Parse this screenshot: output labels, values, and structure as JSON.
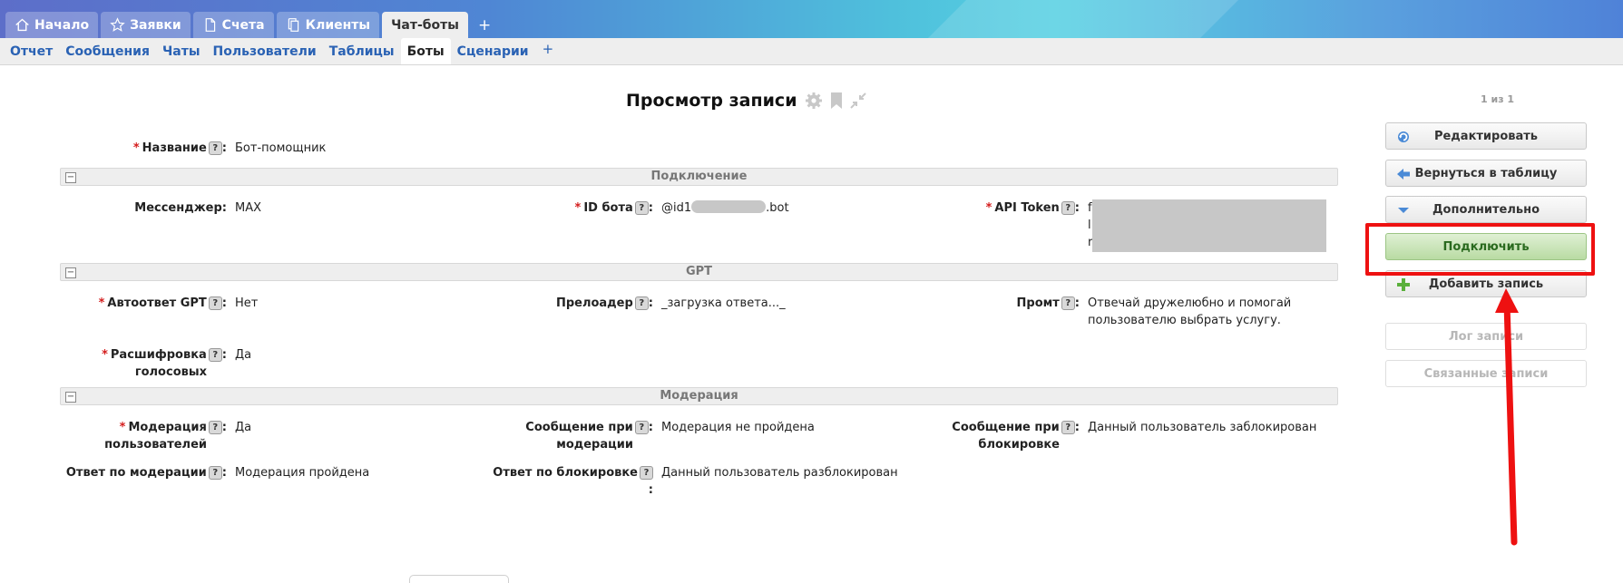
{
  "top_tabs": [
    {
      "label": "Начало",
      "icon": "home-icon"
    },
    {
      "label": "Заявки",
      "icon": "star-icon"
    },
    {
      "label": "Счета",
      "icon": "document-icon"
    },
    {
      "label": "Клиенты",
      "icon": "copy-icon"
    },
    {
      "label": "Чат-боты",
      "active": true
    }
  ],
  "top_tabs_plus": "+",
  "sub_tabs": [
    {
      "label": "Отчет"
    },
    {
      "label": "Сообщения"
    },
    {
      "label": "Чаты"
    },
    {
      "label": "Пользователи"
    },
    {
      "label": "Таблицы"
    },
    {
      "label": "Боты",
      "active": true
    },
    {
      "label": "Сценарии"
    }
  ],
  "sub_tabs_plus": "+",
  "page": {
    "title": "Просмотр записи",
    "pager": "1 из 1",
    "title_icons": [
      "gear-icon",
      "bookmark-icon",
      "compress-icon"
    ]
  },
  "fields": {
    "name": {
      "label": "Название",
      "help": "?",
      "value": "Бот-помощник"
    },
    "messenger": {
      "label": "Мессенджер:",
      "value": "MAX"
    },
    "bot_id": {
      "label": "ID бота",
      "value_prefix": "@id1",
      "value_suffix": ".bot"
    },
    "api_token": {
      "label": "API Token",
      "value_lines": [
        "f",
        "l",
        "r"
      ]
    },
    "autoreply_gpt": {
      "label": "Автоответ GPT",
      "value": "Нет"
    },
    "preloader": {
      "label": "Прелоадер",
      "value": "_загрузка ответа..._"
    },
    "prompt": {
      "label": "Промт",
      "value_lines": [
        "Отвечай дружелюбно и помогай",
        "пользователю выбрать услугу."
      ]
    },
    "voice_decode": {
      "label_lines": [
        "Расшифровка",
        "голосовых"
      ],
      "value": "Да"
    },
    "user_moderation": {
      "label_lines": [
        "Модерация",
        "пользователей"
      ],
      "value": "Да"
    },
    "moderation_message": {
      "label_lines": [
        "Сообщение при",
        "модерации"
      ],
      "value": "Модерация не пройдена"
    },
    "block_message": {
      "label_lines": [
        "Сообщение при",
        "блокировке"
      ],
      "value": "Данный пользователь заблокирован"
    },
    "moderation_reply": {
      "label": "Ответ по модерации",
      "value": "Модерация пройдена"
    },
    "block_reply": {
      "label": "Ответ по блокировке",
      "value": "Данный пользователь разблокирован"
    }
  },
  "sections": {
    "connection": {
      "title": "Подключение",
      "toggle": "−"
    },
    "gpt": {
      "title": "GPT",
      "toggle": "−"
    },
    "moderation": {
      "title": "Модерация",
      "toggle": "−"
    }
  },
  "side_buttons": {
    "edit": {
      "label": "Редактировать",
      "icon": "refresh-icon"
    },
    "back": {
      "label": "Вернуться в таблицу",
      "icon": "arrow-left-icon"
    },
    "more": {
      "label": "Дополнительно",
      "icon": "triangle-down-icon"
    },
    "connect": {
      "label": "Подключить"
    },
    "add": {
      "label": "Добавить запись",
      "icon": "plus-icon"
    },
    "log": {
      "label": "Лог записи"
    },
    "related": {
      "label": "Связанные записи"
    }
  },
  "colors": {
    "required_marker": "#d41d1d",
    "link_blue": "#2a62b4",
    "annotation_red": "#ee1111",
    "connect_green": "#2a6a1f"
  }
}
